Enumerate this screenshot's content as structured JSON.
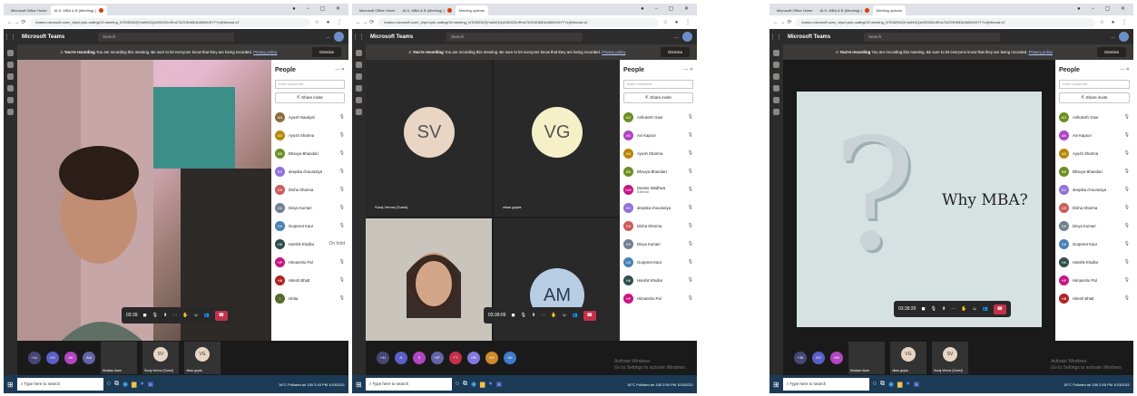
{
  "browser": {
    "tabs": [
      "Microsoft Office Home",
      "ALS- MBA & B (Meeting) | ",
      "Meeting options"
    ],
    "url": "teams.microsoft.com/_#/pre-join-calling/19:meeting_NTM5ZWZjYzktNGQzMS00ZmRmLTlIZGEtMDA4MWU5YTYz@thread.v2"
  },
  "teams": {
    "title": "Microsoft Teams",
    "search_placeholder": "Search",
    "more": "...",
    "banner_bold": "You're recording",
    "banner_text": "You are recording this meeting. Be sure to let everyone know that they are being recorded.",
    "banner_link": "Privacy policy",
    "dismiss": "Dismiss"
  },
  "people_panel": {
    "title": "People",
    "invite_placeholder": "Invite someone",
    "share_invite": "Share invite"
  },
  "panel1": {
    "timer": "03:39",
    "presenter_label": "Suraj Verma",
    "people": [
      {
        "initials": "AN",
        "name": "Ayush Nautiyal",
        "color": "#8a6d3b",
        "status": ""
      },
      {
        "initials": "AS",
        "name": "Ayush Sharma",
        "color": "#b8860b",
        "status": ""
      },
      {
        "initials": "BB",
        "name": "Bhavya Bhandari",
        "color": "#6b8e23",
        "status": ""
      },
      {
        "initials": "DC",
        "name": "deepika chourasiya",
        "color": "#9370db",
        "status": ""
      },
      {
        "initials": "DS",
        "name": "Disha Sharma",
        "color": "#cd5c5c",
        "status": ""
      },
      {
        "initials": "DK",
        "name": "Divya Kumari",
        "color": "#708090",
        "status": ""
      },
      {
        "initials": "GK",
        "name": "Gurpreet Kaur",
        "color": "#4682b4",
        "status": ""
      },
      {
        "initials": "HK",
        "name": "Harshit Khullar",
        "color": "#2f4f4f",
        "status": "On hold"
      },
      {
        "initials": "HP",
        "name": "Himanshu Pal",
        "color": "#c71585",
        "status": ""
      },
      {
        "initials": "HB",
        "name": "Hitesh Bhatt",
        "color": "#b22222",
        "status": ""
      },
      {
        "initials": "I",
        "name": "Ishita",
        "color": "#556b2f",
        "status": ""
      }
    ],
    "strip": [
      {
        "initials": "+41",
        "color": "#464775"
      },
      {
        "initials": "KS",
        "color": "#5b5fc7"
      },
      {
        "initials": "AK",
        "color": "#b146c2"
      },
      {
        "initials": "AM",
        "color": "#6264a7"
      }
    ],
    "thumbs": [
      "Muskan Alam",
      "Suraj Verma (Guest)",
      "vikas gupta"
    ],
    "thumb_initials": [
      "SV",
      "VG"
    ]
  },
  "panel2": {
    "timer": "03:39:09",
    "tiles": [
      {
        "initials": "SV",
        "name": "Suraj Verma (Guest)",
        "color": "#e8d5c4",
        "text": "#555"
      },
      {
        "initials": "VG",
        "name": "vikas gupta",
        "color": "#f6f0c8",
        "text": "#555"
      }
    ],
    "video_label": "Akshita Mehra",
    "am_initials": "AM",
    "people": [
      {
        "initials": "AG",
        "name": "Ashutosh Gaur",
        "color": "#6b8e23"
      },
      {
        "initials": "AK",
        "name": "Avi Kapoor",
        "color": "#b146c2"
      },
      {
        "initials": "AS",
        "name": "Ayush Sharma",
        "color": "#b8860b"
      },
      {
        "initials": "BB",
        "name": "Bhavya Bhandari",
        "color": "#6b8e23"
      },
      {
        "initials": "DW",
        "name": "Damini Wadhwa",
        "color": "#c71585",
        "sub": "External"
      },
      {
        "initials": "DC",
        "name": "deepika chourasiya",
        "color": "#9370db"
      },
      {
        "initials": "DS",
        "name": "Disha Sharma",
        "color": "#cd5c5c"
      },
      {
        "initials": "DK",
        "name": "Divya Kumari",
        "color": "#708090"
      },
      {
        "initials": "GK",
        "name": "Gurpreet Kaur",
        "color": "#4682b4"
      },
      {
        "initials": "HK",
        "name": "Harshit Khullar",
        "color": "#2f4f4f"
      },
      {
        "initials": "HP",
        "name": "Himanshu Pal",
        "color": "#c71585"
      }
    ],
    "strip": [
      "+41",
      "N",
      "S",
      "HP",
      "TT",
      "HB",
      "KS",
      "AK"
    ]
  },
  "panel3": {
    "timer": "03:39:20",
    "slide_title": "Why MBA?",
    "slide_mark": "?",
    "presenter_label": "Damini Wadhwa",
    "people": [
      {
        "initials": "AG",
        "name": "Ashutosh Gaur",
        "color": "#6b8e23"
      },
      {
        "initials": "AK",
        "name": "Avi Kapoor",
        "color": "#b146c2"
      },
      {
        "initials": "AS",
        "name": "Ayush Sharma",
        "color": "#b8860b"
      },
      {
        "initials": "BB",
        "name": "Bhavya Bhandari",
        "color": "#6b8e23"
      },
      {
        "initials": "DC",
        "name": "deepika chourasiya",
        "color": "#9370db"
      },
      {
        "initials": "DS",
        "name": "Disha Sharma",
        "color": "#cd5c5c"
      },
      {
        "initials": "DK",
        "name": "Divya Kumari",
        "color": "#708090"
      },
      {
        "initials": "GK",
        "name": "Gurpreet Kaur",
        "color": "#4682b4"
      },
      {
        "initials": "HK",
        "name": "Harshit Khullar",
        "color": "#2f4f4f"
      },
      {
        "initials": "HP",
        "name": "Himanshu Pal",
        "color": "#c71585"
      },
      {
        "initials": "HB",
        "name": "Hitesh Bhatt",
        "color": "#b22222"
      }
    ],
    "strip": [
      "+38",
      "KS",
      "AM"
    ],
    "thumbs": [
      "Muskan Alam",
      "vikas gupta",
      "Suraj Verma (Guest)"
    ],
    "thumb_initials": [
      "VG",
      "SV"
    ]
  },
  "watermark": "Activate Windows",
  "watermark_sub": "Go to Settings to activate Windows.",
  "taskbar": {
    "search": "Type here to search",
    "tray1": "34°C Polluted air 155",
    "time1": "2:43 PM",
    "date1": "10/3/2021",
    "tray2": "34°C Polluted air 155",
    "time2": "2:50 PM",
    "date2": "10/3/2021",
    "tray3": "34°C Polluted air 155",
    "time3": "2:55 PM",
    "date3": "10/3/2021"
  }
}
